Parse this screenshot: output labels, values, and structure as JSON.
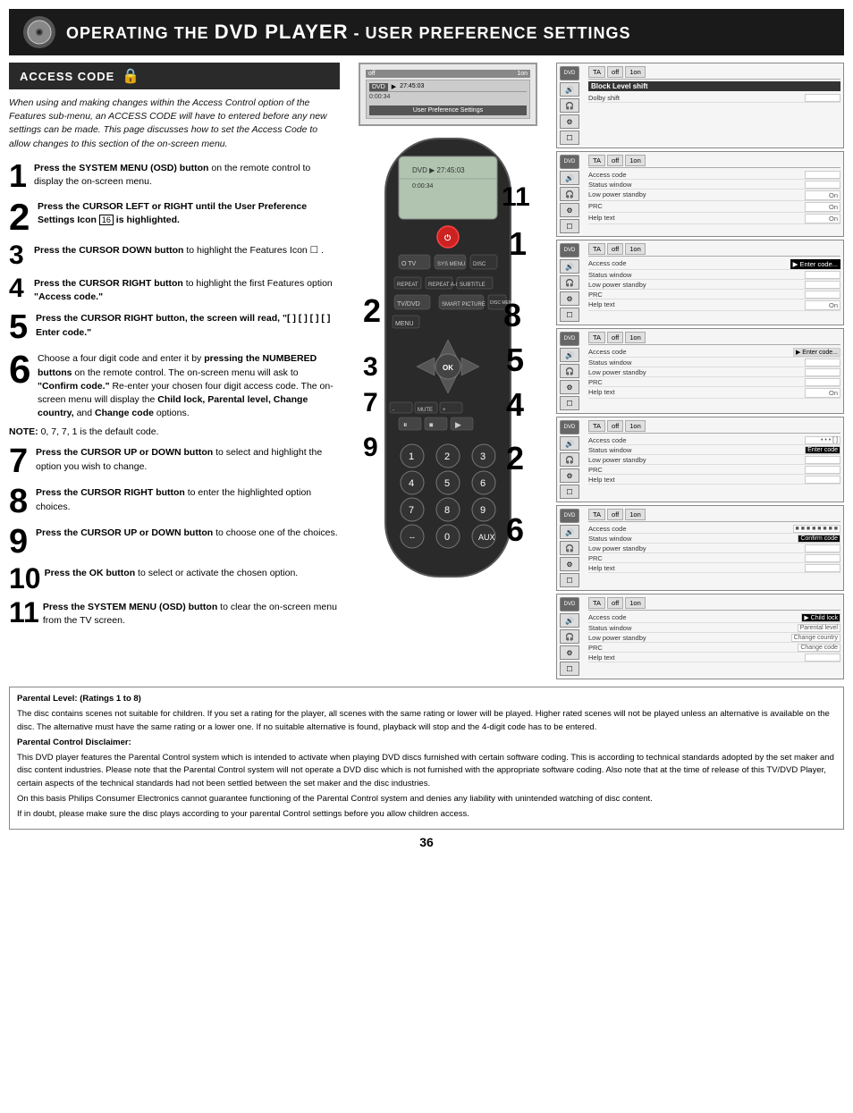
{
  "header": {
    "title_prefix": "Operating the ",
    "title_dvd": "DVD Player",
    "title_suffix": " - User Preference Settings"
  },
  "section": {
    "title": "Access Code"
  },
  "intro": {
    "text": "When using and making changes within the Access Control option of the Features sub-menu, an ACCESS CODE will have to entered before any new settings can be made. This page discusses how to set the Access Code to allow changes to this section of the on-screen menu."
  },
  "steps": [
    {
      "num": "1",
      "size": "normal",
      "text_bold": "Press the SYSTEM MENU (OSD) button",
      "text_rest": " on the remote control to display the on-screen menu."
    },
    {
      "num": "2",
      "size": "large",
      "text_bold": "Press the CURSOR LEFT or RIGHT until the User Preference Settings Icon",
      "text_rest": " is highlighted.",
      "icon": "⬛"
    },
    {
      "num": "3",
      "size": "normal",
      "text_bold": "Press the CURSOR DOWN button",
      "text_rest": " to highlight the Features  Icon ☐ ."
    },
    {
      "num": "4",
      "size": "normal",
      "text_bold": "Press the CURSOR RIGHT button",
      "text_rest": " to highlight the first Features option \"Access code.\""
    },
    {
      "num": "5",
      "size": "large",
      "text_bold": "Press the CURSOR  RIGHT button, the screen will read,",
      "text_rest": "  \"[ ] [ ] [ ] [ ] Enter code.\""
    },
    {
      "num": "6",
      "size": "xlarge",
      "text_bold": "Choose a four digit code and enter it by pressing the NUMBERED buttons",
      "text_rest": " on the remote control. The on-screen menu will ask to \"Confirm code.\" Re-enter your chosen four digit access code. The on-screen menu will display the Child lock, Parental level, Change country, and Change code options."
    },
    {
      "num": "NOTE",
      "text": "NOTE: 0, 7, 7, 1 is the default code."
    },
    {
      "num": "7",
      "size": "large",
      "text_bold": "Press the CURSOR UP or DOWN button",
      "text_rest": " to select and highlight the option you wish to change."
    },
    {
      "num": "8",
      "size": "large",
      "text_bold": "Press the CURSOR RIGHT button",
      "text_rest": " to enter the highlighted option choices."
    },
    {
      "num": "9",
      "size": "large",
      "text_bold": "Press the CURSOR UP or DOWN button",
      "text_rest": " to choose one of the choices."
    },
    {
      "num": "10",
      "size": "xlarge",
      "text_bold": "Press the OK button",
      "text_rest": " to select or activate the chosen option."
    },
    {
      "num": "11",
      "size": "xlarge",
      "text_bold": "Press the SYSTEM MENU (OSD) button",
      "text_rest": " to clear the on-screen menu from the TV screen."
    }
  ],
  "screens": [
    {
      "id": "screen1",
      "header": [
        "TA",
        "off",
        "1on"
      ],
      "title": "Block Level shift",
      "rows": [
        {
          "label": "Dolby shift",
          "value": ""
        }
      ]
    },
    {
      "id": "screen2",
      "header": [
        "TA",
        "off",
        "1on"
      ],
      "title": "",
      "rows": [
        {
          "label": "Access code",
          "value": ""
        },
        {
          "label": "Status window",
          "value": ""
        },
        {
          "label": "Low power standby",
          "value": "On"
        },
        {
          "label": "PRC",
          "value": "On"
        },
        {
          "label": "Help text",
          "value": "On"
        }
      ]
    },
    {
      "id": "screen3",
      "header": [
        "TA",
        "off",
        "1on"
      ],
      "title": "",
      "rows": [
        {
          "label": "Access code",
          "value": "Enter code...",
          "highlighted": true
        },
        {
          "label": "Status window",
          "value": ""
        },
        {
          "label": "Low power standby",
          "value": ""
        },
        {
          "label": "PRC",
          "value": ""
        },
        {
          "label": "Help text",
          "value": "On"
        }
      ]
    },
    {
      "id": "screen4",
      "header": [
        "TA",
        "off",
        "1on"
      ],
      "title": "",
      "rows": [
        {
          "label": "Access code",
          "value": "▶ Enter code...",
          "highlighted": true
        },
        {
          "label": "Status window",
          "value": ""
        },
        {
          "label": "Low power standby",
          "value": ""
        },
        {
          "label": "PRC",
          "value": ""
        },
        {
          "label": "Help text",
          "value": "On"
        }
      ]
    },
    {
      "id": "screen5",
      "header": [
        "TA",
        "off",
        "1on"
      ],
      "title": "",
      "rows": [
        {
          "label": "Access code",
          "value": "• • • [ ]"
        },
        {
          "label": "Status window",
          "value": "Enter code"
        },
        {
          "label": "Low power standby",
          "value": ""
        },
        {
          "label": "PRC",
          "value": ""
        },
        {
          "label": "Help text",
          "value": ""
        }
      ]
    },
    {
      "id": "screen6",
      "header": [
        "TA",
        "off",
        "1on"
      ],
      "title": "",
      "rows": [
        {
          "label": "Access code",
          "value": "■ ■ ■ ■ ■ ■ ■ ■"
        },
        {
          "label": "Status window",
          "value": "Confirm code"
        },
        {
          "label": "Low power standby",
          "value": ""
        },
        {
          "label": "PRC",
          "value": ""
        },
        {
          "label": "Help text",
          "value": ""
        }
      ]
    },
    {
      "id": "screen7",
      "header": [
        "TA",
        "off",
        "1on"
      ],
      "title": "",
      "rows": [
        {
          "label": "Access code",
          "value": "▶ Child lock",
          "highlighted": true
        },
        {
          "label": "Status window",
          "value": "Parental level"
        },
        {
          "label": "Low power standby",
          "value": "Change country"
        },
        {
          "label": "PRC",
          "value": "Change code"
        },
        {
          "label": "Help text",
          "value": ""
        }
      ]
    }
  ],
  "bottom_notes": {
    "parental_title": "Parental Level: (Ratings 1 to 8)",
    "parental_text": "The disc contains scenes not suitable for children. If you set a rating for the player, all scenes with the same rating or lower will be played. Higher rated scenes will not be played unless an alternative is available on the disc. The alternative must have the same rating or a lower one. If no suitable alternative is found, playback will stop and the 4-digit code has to be entered.",
    "disclaimer_title": "Parental Control Disclaimer:",
    "disclaimer_text": "This DVD player features the Parental Control system which is intended to activate when playing DVD discs furnished with certain software coding. This is according to technical standards adopted by the set maker and disc content industries. Please note that the Parental Control system will not operate a DVD disc which is not furnished with the appropriate software coding. Also note that at the time of release of this TV/DVD Player, certain aspects of the technical standards had not been settled between the set maker and the disc industries.",
    "disclaimer_text2": "On this basis Philips Consumer Electronics cannot guarantee functioning of the Parental Control system and denies any liability with unintended watching of disc content.",
    "disclaimer_text3": "If in doubt, please make sure the disc plays according to your parental Control settings before you allow children access."
  },
  "page_number": "36"
}
